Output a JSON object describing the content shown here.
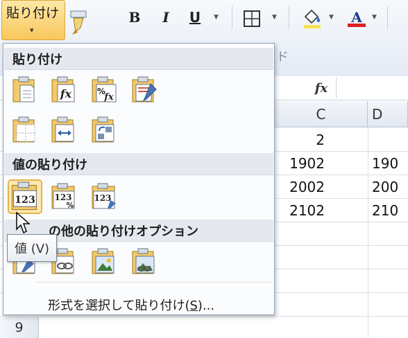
{
  "ribbon": {
    "paste_label": "貼り付け",
    "paste_arrow": "▾",
    "bold_label": "B",
    "italic_label": "I",
    "underline_label": "U",
    "font_color_label": "A",
    "clipboard_group_label": "ード"
  },
  "formula_bar": {
    "fx_label": "fx"
  },
  "sheet": {
    "columns": [
      "C",
      "D"
    ],
    "cells": [
      {
        "col": "C",
        "value": "2"
      },
      {
        "col": "C",
        "value": "1902"
      },
      {
        "col": "C",
        "value": "2002"
      },
      {
        "col": "C",
        "value": "2102"
      },
      {
        "col": "D",
        "value": "190"
      },
      {
        "col": "D",
        "value": "200"
      },
      {
        "col": "D",
        "value": "210"
      }
    ],
    "row_number": "9"
  },
  "paste_menu": {
    "section_paste": "貼り付け",
    "section_values": "値の貼り付け",
    "section_other": "の他の貼り付けオプション",
    "value_icons": [
      "123",
      "123",
      "123"
    ],
    "value_icon_badges": [
      "",
      "%",
      "✎"
    ],
    "paste_special": "形式を選択して貼り付け(",
    "paste_special_key": "S",
    "paste_special_suffix": ")..."
  },
  "tooltip": {
    "text": "値 (V)"
  },
  "colors": {
    "accent_orange": "#f9c75d",
    "font_color_red": "#e02020",
    "menu_header_bg": "#e5e9ef"
  }
}
